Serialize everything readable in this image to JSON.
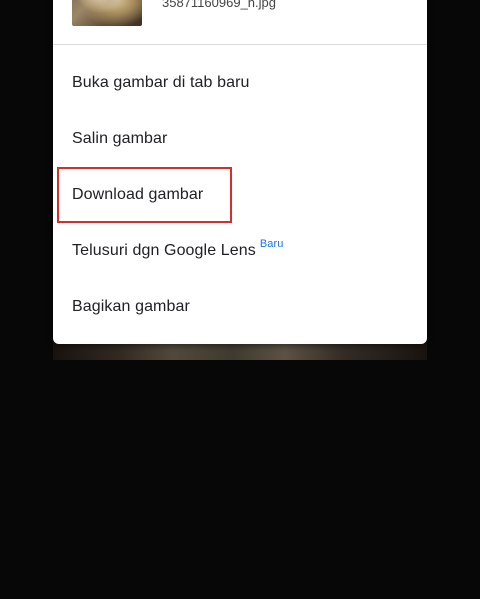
{
  "image_header": {
    "filename": "35871160969_n.jpg"
  },
  "menu": {
    "items": [
      {
        "label": "Buka gambar di tab baru"
      },
      {
        "label": "Salin gambar"
      },
      {
        "label": "Download gambar"
      },
      {
        "label": "Telusuri dgn Google Lens",
        "badge": "Baru"
      },
      {
        "label": "Bagikan gambar"
      }
    ]
  },
  "colors": {
    "highlight": "#d32f2f",
    "badge": "#1a73e8",
    "background": "#070707"
  }
}
